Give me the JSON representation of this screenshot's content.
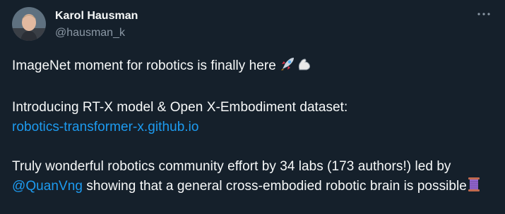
{
  "author": {
    "display_name": "Karol Hausman",
    "handle": "@hausman_k",
    "avatar_icon": "avatar"
  },
  "menu": {
    "icon": "more-options-icon"
  },
  "tweet": {
    "line1_text": "ImageNet moment for robotics is finally here ",
    "line1_emojis": [
      "rocket-emoji",
      "flexed-biceps-emoji"
    ],
    "para2_text": "Introducing RT-X model & Open X-Embodiment dataset:",
    "para2_link": "robotics-transformer-x.github.io",
    "para3_text_a": "Truly wonderful robotics community effort by 34 labs (173 authors!) led by ",
    "para3_mention": "@QuanVng",
    "para3_text_b": " showing that a general cross-embodied robotic brain is possible",
    "para3_emoji": "spool-of-thread-emoji"
  },
  "colors": {
    "background": "#15202b",
    "text": "#f7f9f9",
    "secondary": "#8b98a5",
    "link": "#1d9bf0"
  }
}
